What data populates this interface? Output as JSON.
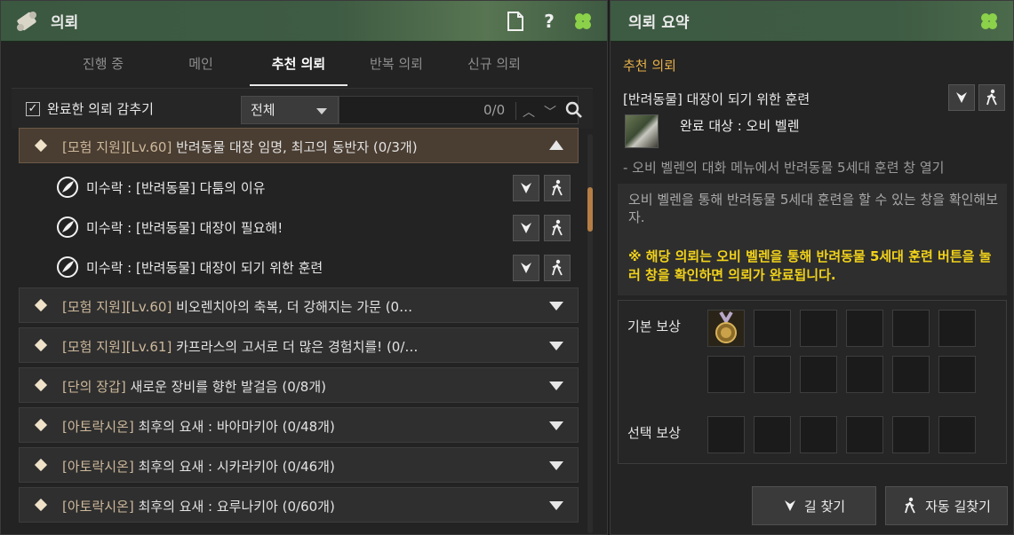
{
  "left_window": {
    "title": "의뢰",
    "tabs": [
      {
        "label": "진행 중"
      },
      {
        "label": "메인"
      },
      {
        "label": "추천 의뢰"
      },
      {
        "label": "반복 의뢰"
      },
      {
        "label": "신규 의뢰"
      }
    ],
    "active_tab": "추천 의뢰",
    "filter": {
      "hide_completed_label": "완료한 의뢰 감추기",
      "hide_completed_checked": true,
      "dropdown_value": "전체",
      "search_count": "0/0"
    },
    "quest_groups": [
      {
        "tag": "[모험 지원][Lv.60]",
        "title": "반려동물 대장 임명, 최고의 동반자 (0/3개)",
        "expanded": true
      },
      {
        "tag": "[모험 지원][Lv.60]",
        "title": "비오렌치아의 축복, 더 강해지는 가문  (0…",
        "expanded": false
      },
      {
        "tag": "[모험 지원][Lv.61]",
        "title": "카프라스의 고서로 더 많은 경험치를! (0/…",
        "expanded": false
      },
      {
        "tag": "[단의 장갑]",
        "title": "새로운 장비를 향한 발걸음 (0/8개)",
        "expanded": false
      },
      {
        "tag": "[아토락시온]",
        "title": "최후의 요새 : 바아마키아 (0/48개)",
        "expanded": false
      },
      {
        "tag": "[아토락시온]",
        "title": "최후의 요새 : 시카라키아 (0/46개)",
        "expanded": false
      },
      {
        "tag": "[아토락시온]",
        "title": "최후의 요새 : 요루나키아 (0/60개)",
        "expanded": false
      }
    ],
    "sub_quests": [
      {
        "text": "미수락 : [반려동물] 다툼의 이유"
      },
      {
        "text": "미수락 : [반려동물] 대장이 필요해!"
      },
      {
        "text": "미수락 : [반려동물] 대장이 되기 위한 훈련"
      }
    ]
  },
  "right_window": {
    "title": "의뢰 요약",
    "section_label": "추천 의뢰",
    "quest_title": "[반려동물] 대장이 되기 위한 훈련",
    "target": "완료 대상 : 오비 벨렌",
    "objective": "- 오비 벨렌의 대화 메뉴에서 반려동물 5세대 훈련 창 열기",
    "description": "오비 벨렌을 통해 반려동물 5세대 훈련을 할 수 있는 창을 확인해보자.",
    "notice": "※ 해당 의뢰는 오비 벨렌을 통해 반려동물 5세대 훈련 버튼을 눌러 창을 확인하면 의뢰가 완료됩니다.",
    "basic_reward_label": "기본 보상",
    "choice_reward_label": "선택 보상",
    "find_path_label": "길 찾기",
    "auto_path_label": "자동 길찾기"
  },
  "colors": {
    "titlebar_green": "#3e5b43",
    "quest_tag": "#cdb89b",
    "section_orange": "#e6b04a",
    "notice_yellow": "#f1d21a"
  },
  "icons": {
    "title": "scroll-icon",
    "document": "document-icon",
    "help": "help-icon",
    "clover": "clover-icon",
    "search": "search-icon",
    "navigate": "navigate-icon",
    "auto_walk": "walking-person-icon",
    "sub_quest": "quill-icon"
  }
}
